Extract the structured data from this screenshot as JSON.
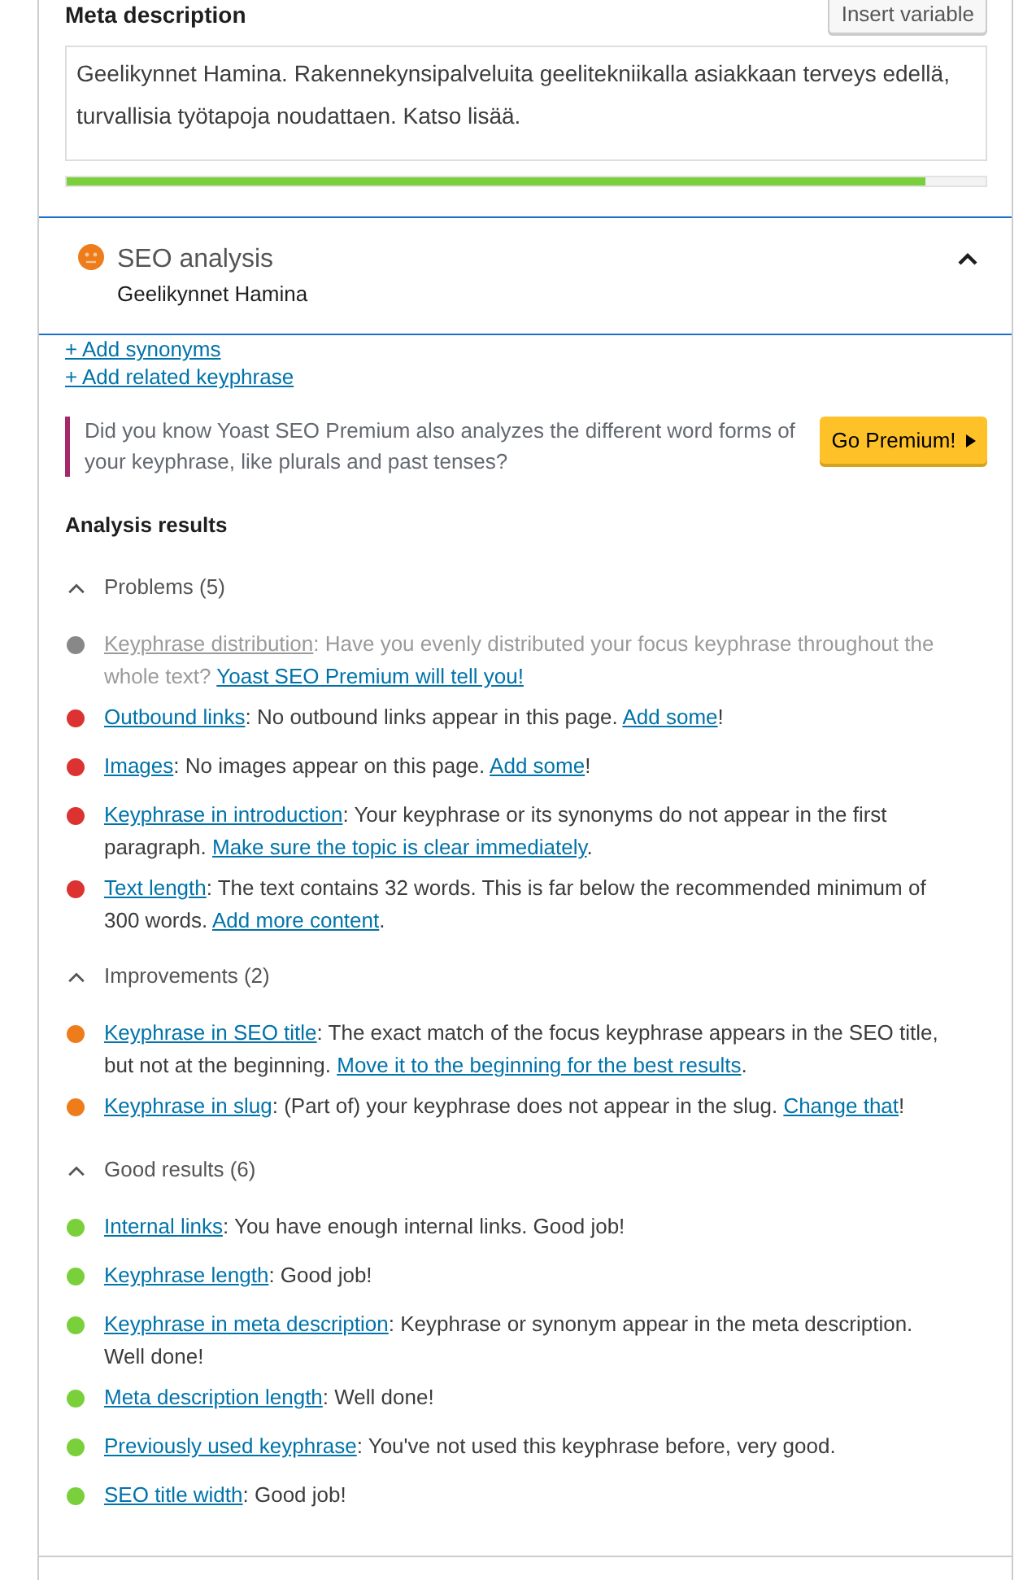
{
  "meta_description": {
    "label": "Meta description",
    "insert_button": "Insert variable",
    "value": "Geelikynnet Hamina. Rakennekynsipalveluita geelitekniikalla asiakkaan terveys edellä, turvallisia työtapoja noudattaen. Katso lisää.",
    "length_meter": {
      "level": 0.935
    }
  },
  "seo_analysis": {
    "score_icon": {
      "kind": "neutral"
    },
    "title": "SEO analysis",
    "keyphrase": "Geelikynnet Hamina",
    "expanded": true,
    "links": [
      "+ Add synonyms",
      "+ Add related keyphrase"
    ],
    "premium_notice": {
      "text": "Did you know Yoast SEO Premium also analyzes the different word forms of your keyphrase, like plurals and past tenses?",
      "button": "Go Premium!"
    },
    "results": {
      "heading": "Analysis results",
      "groups": [
        {
          "title": "Problems (5)",
          "expanded": true,
          "items": [
            {
              "color": "#888888",
              "disabled": true,
              "label": "Keyphrase distribution",
              "segments": [
                {
                  "kind": "text",
                  "text": ": Have you evenly distributed your focus keyphrase throughout the whole text? "
                },
                {
                  "kind": "link",
                  "text": "Yoast SEO Premium will tell you!"
                }
              ]
            },
            {
              "color": "#dc3232",
              "disabled": false,
              "label": "Outbound links",
              "segments": [
                {
                  "kind": "text",
                  "text": ": No outbound links appear in this page. "
                },
                {
                  "kind": "link",
                  "text": "Add some"
                },
                {
                  "kind": "text",
                  "text": "!"
                }
              ]
            },
            {
              "color": "#dc3232",
              "disabled": false,
              "label": "Images",
              "segments": [
                {
                  "kind": "text",
                  "text": ": No images appear on this page. "
                },
                {
                  "kind": "link",
                  "text": "Add some"
                },
                {
                  "kind": "text",
                  "text": "!"
                }
              ]
            },
            {
              "color": "#dc3232",
              "disabled": false,
              "label": "Keyphrase in introduction",
              "segments": [
                {
                  "kind": "text",
                  "text": ": Your keyphrase or its synonyms do not appear in the first paragraph. "
                },
                {
                  "kind": "link",
                  "text": "Make sure the topic is clear immediately"
                },
                {
                  "kind": "text",
                  "text": "."
                }
              ]
            },
            {
              "color": "#dc3232",
              "disabled": false,
              "label": "Text length",
              "segments": [
                {
                  "kind": "text",
                  "text": ": The text contains 32 words. This is far below the recommended minimum of 300 words. "
                },
                {
                  "kind": "link",
                  "text": "Add more content"
                },
                {
                  "kind": "text",
                  "text": "."
                }
              ]
            }
          ]
        },
        {
          "title": "Improvements (2)",
          "expanded": true,
          "items": [
            {
              "color": "#ee7c1b",
              "disabled": false,
              "label": "Keyphrase in SEO title",
              "segments": [
                {
                  "kind": "text",
                  "text": ": The exact match of the focus keyphrase appears in the SEO title, but not at the beginning. "
                },
                {
                  "kind": "link",
                  "text": "Move it to the beginning for the best results"
                },
                {
                  "kind": "text",
                  "text": "."
                }
              ]
            },
            {
              "color": "#ee7c1b",
              "disabled": false,
              "label": "Keyphrase in slug",
              "segments": [
                {
                  "kind": "text",
                  "text": ": (Part of) your keyphrase does not appear in the slug. "
                },
                {
                  "kind": "link",
                  "text": "Change that"
                },
                {
                  "kind": "text",
                  "text": "!"
                }
              ]
            }
          ]
        },
        {
          "title": "Good results (6)",
          "expanded": true,
          "items": [
            {
              "color": "#7ad03a",
              "disabled": false,
              "label": "Internal links",
              "segments": [
                {
                  "kind": "text",
                  "text": ": You have enough internal links. Good job!"
                }
              ]
            },
            {
              "color": "#7ad03a",
              "disabled": false,
              "label": "Keyphrase length",
              "segments": [
                {
                  "kind": "text",
                  "text": ": Good job!"
                }
              ]
            },
            {
              "color": "#7ad03a",
              "disabled": false,
              "label": "Keyphrase in meta description",
              "segments": [
                {
                  "kind": "text",
                  "text": ": Keyphrase or synonym appear in the meta description. Well done!"
                }
              ]
            },
            {
              "color": "#7ad03a",
              "disabled": false,
              "label": "Meta description length",
              "segments": [
                {
                  "kind": "text",
                  "text": ": Well done!"
                }
              ]
            },
            {
              "color": "#7ad03a",
              "disabled": false,
              "label": "Previously used keyphrase",
              "segments": [
                {
                  "kind": "text",
                  "text": ": You've not used this keyphrase before, very good."
                }
              ]
            },
            {
              "color": "#7ad03a",
              "disabled": false,
              "label": "SEO title width",
              "segments": [
                {
                  "kind": "text",
                  "text": ": Good job!"
                }
              ]
            }
          ]
        }
      ]
    }
  }
}
